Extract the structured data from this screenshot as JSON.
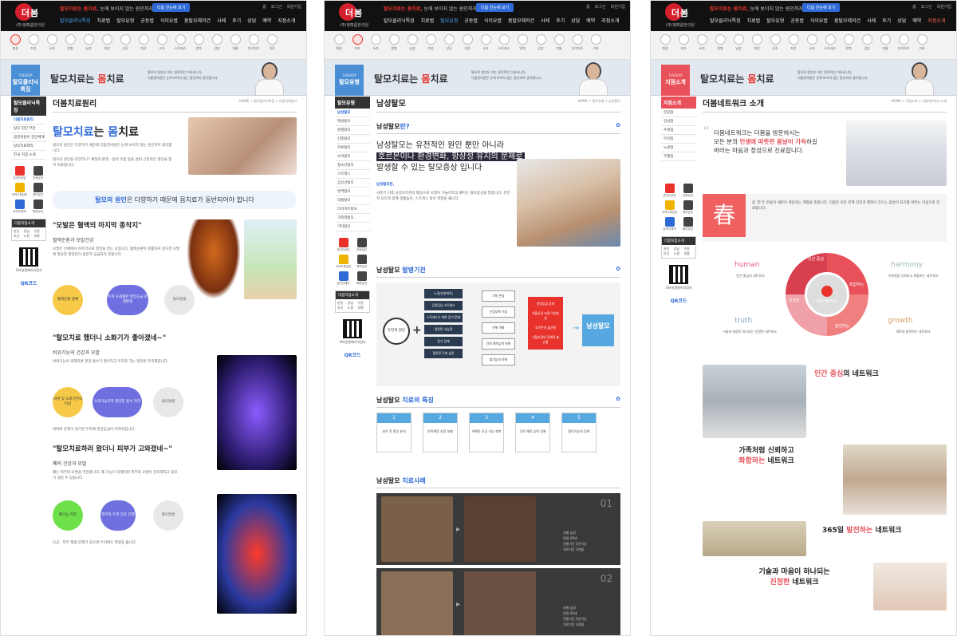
{
  "header": {
    "logo_text": "더봄",
    "logo_sub": "한의원",
    "logo_sub2": "(주)정뽀릅한의원",
    "slogan_lead": "탈모치료는 몸치료,",
    "slogan_rest": "눈에 보이지 않는 원인까지",
    "cta": "더봄 한눈에 보기",
    "utils": [
      "홈",
      "로그인",
      "회원가입",
      "사이트맵",
      "즐겨찾기"
    ]
  },
  "nav": {
    "panel1": [
      "탈모클리닉특징",
      "치료법",
      "탈모유형",
      "공동법",
      "식이요법",
      "봄탈모레저건",
      "사례",
      "후기",
      "상담",
      "예약",
      "지점소개"
    ],
    "panel2": [
      "탈모클리닉특징",
      "치료법",
      "탈모유형",
      "공동법",
      "식이요법",
      "봄탈모레저건",
      "사례",
      "후기",
      "상담",
      "예약",
      "지점소개"
    ],
    "panel3": [
      "탈모클리닉특징",
      "치료법",
      "탈모유형",
      "공동법",
      "식이요법",
      "봄탈모레저건",
      "사례",
      "후기",
      "상담",
      "예약",
      "지점소개"
    ]
  },
  "iconbar": [
    "체질",
    "자가",
    "두피",
    "원형",
    "남성",
    "여성",
    "산후",
    "지루",
    "소아",
    "스트레스",
    "면역",
    "갑상",
    "약물",
    "다이어트",
    "가족",
    "유전",
    "스트레스",
    "두피",
    "관리",
    "검사",
    "탈모"
  ],
  "panel1": {
    "banner_tab": "탈모클리닉특징",
    "banner_tab_small": "THEBOM",
    "banner_title_pre": "탈모치료는 ",
    "banner_title_em": "몸",
    "banner_title_post": "치료",
    "banner_copy": [
      "탈모의 원인은 이는 원적적인 이유요니다.",
      "더봄한의원은 눈에 보이지 않는 원인까지 생각합니다."
    ],
    "sidebar_head": "탈모클리닉특징",
    "sidebar": [
      "더봄치료원리",
      "탈모 진단 부문",
      "봄한의원이 진단체계",
      "탈모치료제작",
      "전국 지점 소개"
    ],
    "quick": [
      "온라인상담",
      "전화상담",
      "카카오톡상담",
      "예약상담",
      "온라인예약",
      "빠른상담"
    ],
    "map_head": "더봄지점소개",
    "map_cities": [
      "분당",
      "강남",
      "수원",
      "부산",
      "노원",
      "부평"
    ],
    "qr_label": "모바일홈페이지접속",
    "qr_code": "QR코드",
    "title": "더봄치료원리",
    "breadcrumb": "HOME > 탈모클리닉특징 > 더봄치료원리",
    "headline_pre": "탈모치료",
    "headline_mid": "는 ",
    "headline_em": "몸",
    "headline_post": "치료",
    "intro": "탈모의 원인은 다양하기 때문에 더봄한의원은 눈에 보이지 않는 원인까지 생각합니다.",
    "intro2": "탈모의 원인을 다양하니? 체질과 환경 · 몸의 흐름 등을 살펴 근본적인 원인을 찾아 치료합니다.",
    "callout_pre": "탈모의 원인",
    "callout_post": "은 다양하기 때문에 몸치료가 동반되어야 합니다",
    "q1": "\"모발은 혈액의 마지막 종착지\"",
    "q1_sub": "혈액순환과 모발건강",
    "q1_body": "모발은 인체에서 마지막으로 영양을 받는 곳입니다. 혈액순환이 원활하지 않으면 모발에 필요한 영양분이 충분히 공급되지 못합니다.",
    "q1_flow": [
      "혈액순환 정체",
      "두피 모세혈관 영양공급 문제발생",
      "탈모발생"
    ],
    "q2": "\"탈모치료 했더니 소화기가 좋아졌네~\"",
    "q2_sub": "비위기능의 건강과 모발",
    "q2_body": "비위기능이 약해지면 영양 흡수가 떨어지고 두피로 가는 영양이 부족해집니다.",
    "q2_flow": [
      "비위 및 소화기관의 이상",
      "소화기능저하 영양분 흡수 저하",
      "탈모발생"
    ],
    "q2_note": "비위에 문제가 생기면 두피에 영양공급이 어려워집니다.",
    "q3": "\"탈모치료하러 왔더니 피부가 고와졌네~\"",
    "q3_sub": "폐의 건강과 모발",
    "q3_body": "폐는 피부와 모발을 주관합니다. 폐 기능이 약해지면 피부와 모발이 건조해지고 탈모가 생길 수 있습니다.",
    "q3_flow": [
      "폐기능 저하",
      "피부와 두피 건조 진행",
      "탈모발생"
    ],
    "q3_note": "모공 · 피부 재생 문제가 있으면 두피에도 영향을 줍니다."
  },
  "panel2": {
    "banner_tab": "탈모유형",
    "banner_tab_small": "THEBOM",
    "banner_title_pre": "탈모치료는 ",
    "banner_title_em": "몸",
    "banner_title_post": "치료",
    "banner_copy": [
      "탈모의 원인은 이는 원적적인 이유요니다.",
      "더봄한의원은 눈에 보이지 않는 원인까지 생각합니다."
    ],
    "sidebar_head": "탈모유형",
    "sidebar": [
      "남성탈모",
      "여성탈모",
      "원형탈모",
      "산후탈모",
      "지루탈모",
      "소아탈모",
      "청소년탈모",
      "스트레스",
      "갑상선탈모",
      "면역탈모",
      "약물탈모",
      "다이어트탈모",
      "가족력탈모",
      "기타탈모"
    ],
    "quick": [
      "온라인상담",
      "전화상담",
      "카카오톡상담",
      "예약상담",
      "온라인예약",
      "빠른상담"
    ],
    "map_head": "더봄지점소개",
    "map_cities": [
      "분당",
      "강남",
      "수원",
      "부산",
      "노원",
      "부평"
    ],
    "qr_label": "모바일홈페이지접속",
    "qr_code": "QR코드",
    "title": "남성탈모",
    "breadcrumb": "HOME > 탈모유형 > 남성탈모",
    "s1_pre": "남성탈모",
    "s1_em": "란?",
    "hl_1": "남성탈모는 유전적인 원인 뿐만 아니라",
    "hl_2": "호르몬이나 환경변화, 항상성 유지의 문제로",
    "hl_3": "발생할 수 있는 탈모증상 입니다",
    "p_head": "남성탈모란,",
    "p_body": "사춘기 이후 남성호르몬의 활동으로 모발이 가늘어지고 빠지는 탈모증상을 말합니다. 유전적 요인과 함께 생활습관, 스트레스 등이 영향을 줍니다.",
    "s2_pre": "남성탈모",
    "s2_em": "발병기전",
    "mech_left": "유전적 원인",
    "mech_col1": [
      "노권(만성피로)",
      "간장담낭 스트레스",
      "스트레스가 위한 장기 문제",
      "절못된 식습관",
      "음식 장애",
      "잘못된 두피 습관"
    ],
    "mech_col2": [
      "기의 손상",
      "신장부족 이상",
      "비위 약화",
      "간의 해독능력 약화",
      "혈기능의 약화"
    ],
    "mech_col3": [
      "영양공급 장애",
      "자율신경 조절 이상발생",
      "호르몬의 불균형",
      "기혈순환의 전체적 불균형"
    ],
    "mech_result": "남성탈모",
    "s3_pre": "남성탈모",
    "s3_em": "치료의 특징",
    "feats": [
      {
        "n": "1",
        "t": "과거 전 원인 분석"
      },
      {
        "n": "2",
        "t": "부족해진 신장 보충"
      },
      {
        "n": "3",
        "t": "약해진 모공 기능 회복"
      },
      {
        "n": "4",
        "t": "간의 해독 능력 강화"
      },
      {
        "n": "5",
        "t": "탈모기능의 강화"
      }
    ],
    "s4_pre": "남성탈모",
    "s4_em": "치료사례",
    "s4_btn": "치료사례 더보기",
    "cases": [
      {
        "no": "01",
        "info": [
          "성별 남성",
          "연령 29세",
          "진행기간 5년이상",
          "치료기간 3개월"
        ]
      },
      {
        "no": "02",
        "info": [
          "성별 남성",
          "연령 29세",
          "진행기간 5년이상",
          "치료기간 3개월"
        ]
      }
    ]
  },
  "panel3": {
    "banner_tab": "지점소개",
    "banner_tab_small": "THEBOM",
    "banner_title_pre": "탈모치료는 ",
    "banner_title_em": "몸",
    "banner_title_post": "치료",
    "banner_copy": [
      "탈모의 원인은 이는 원적적인 이유요니다.",
      "더봄한의원은 눈에 보이지 않는 원인까지 생각합니다."
    ],
    "sidebar_head": "지점소개",
    "sidebar": [
      "분당점",
      "강남점",
      "수원점",
      "부산점",
      "노원점",
      "부평점"
    ],
    "quick": [
      "온라인상담",
      "전화상담",
      "카카오톡상담",
      "예약상담",
      "온라인예약",
      "빠른상담"
    ],
    "map_head": "더봄지점소개",
    "map_cities": [
      "분당",
      "강남",
      "수원",
      "부산",
      "노원",
      "부평"
    ],
    "qr_label": "모바일홈페이지접속",
    "qr_code": "QR코드",
    "title": "더봄네트워크 소개",
    "breadcrumb": "HOME > 지점소개 > 더봄네트워크 소개",
    "intro_a": "더봄네트워크는 더봄을 방문하시는",
    "intro_b_pre": "모든 분의 ",
    "intro_b_em": "인생에 따뜻한 봄날이 가득",
    "intro_b_post": "하길",
    "intro_c": "바라는 마음과 정성으로 진료합니다.",
    "spring": "春",
    "spring_text": "봄 '춘'은 만물이 새로이 생동하는 계절을 뜻합니다. 더봄은 모든 분께 건강과 행복이 깃드는 봄날이 되기를 바라는 마음으로 진료합니다.",
    "labels": {
      "human": "human",
      "harmony": "harmony",
      "truth": "truth",
      "growth": "growth"
    },
    "label_texts": {
      "human": "인간 중심의 네트워크",
      "harmony": "가족처럼 신뢰하고 화합하는 네트워크",
      "truth": "기술과 마음이 하나되는 진정한 네트워크",
      "growth": "365일 발전하는 네트워크"
    },
    "ring": [
      "인간 중심",
      "화합하는",
      "발전하는",
      "진정한"
    ],
    "network_title": "NETWORK",
    "blocks": [
      {
        "pre": "",
        "em": "인간 중심",
        "post": "의 네트워크"
      },
      {
        "pre": "가족처럼 신뢰하고",
        "em": "화합하는",
        "post": " 네트워크"
      },
      {
        "pre": "365일 ",
        "em": "발전하는",
        "post": " 네트워크"
      },
      {
        "pre": "기술과 마음이 하나되는",
        "em": "진정한",
        "post": " 네트워크"
      }
    ]
  }
}
